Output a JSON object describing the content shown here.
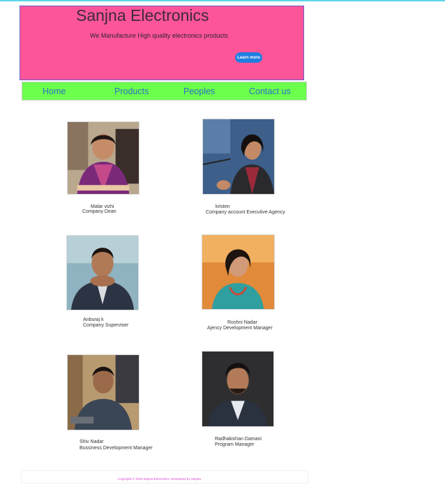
{
  "header": {
    "title": "Sanjna Electronics",
    "subtitle": "We Manufacture High quality electronics  products",
    "learn_more": "Learn more"
  },
  "nav": {
    "items": [
      "Home",
      "Products",
      "Peoples",
      "Contact us"
    ]
  },
  "people": [
    {
      "name": "Malar vizhi",
      "role": "Company Dean"
    },
    {
      "name": "kristen",
      "role": "Company account Executive Agency"
    },
    {
      "name": "Anburaj k",
      "role": "Company Superviser"
    },
    {
      "name": "Roshni Nadar",
      "role": "Ajency Development Manager"
    },
    {
      "name": "Shiv Nadar",
      "role": "Bussiness Development Manager"
    },
    {
      "name": "Radhakishan Damani",
      "role": "Program Manager"
    }
  ],
  "footer": {
    "copyright": "Copyright © 2020 Sanjna Electronics, Developed by Sanjna"
  },
  "colors": {
    "hero_bg": "#fd5598",
    "nav_bg": "#6cff4c",
    "nav_text": "#2d6fc4",
    "button": "#1f7ee0",
    "footer_text": "#d445d0"
  }
}
